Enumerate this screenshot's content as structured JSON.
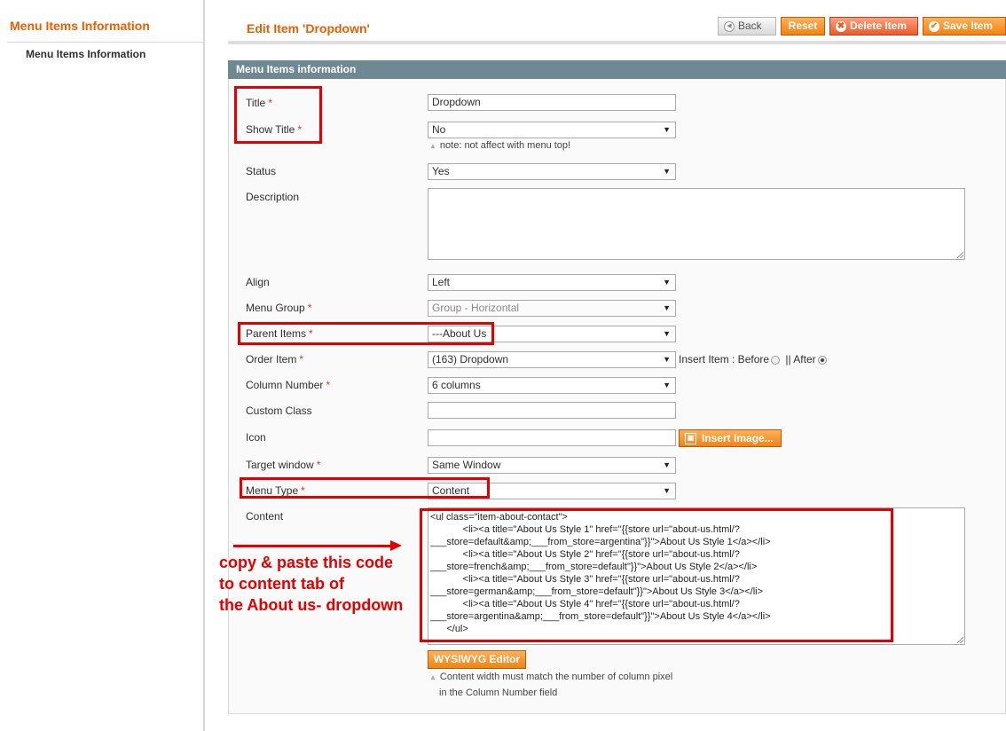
{
  "sidebar": {
    "title": "Menu Items Information",
    "items": [
      {
        "label": "Menu Items Information"
      }
    ]
  },
  "header": {
    "title": "Edit Item 'Dropdown'",
    "buttons": {
      "back": "Back",
      "reset": "Reset",
      "delete": "Delete Item",
      "save": "Save Item"
    }
  },
  "panel": {
    "title": "Menu Items information"
  },
  "form": {
    "title": {
      "label": "Title",
      "value": "Dropdown"
    },
    "show_title": {
      "label": "Show Title",
      "value": "No",
      "note": "note: not affect with menu top!"
    },
    "status": {
      "label": "Status",
      "value": "Yes"
    },
    "description": {
      "label": "Description",
      "value": ""
    },
    "align": {
      "label": "Align",
      "value": "Left"
    },
    "menu_group": {
      "label": "Menu Group",
      "value": "Group - Horizontal"
    },
    "parent_items": {
      "label": "Parent Items",
      "value": "---About Us"
    },
    "order_item": {
      "label": "Order Item",
      "value": "(163) Dropdown",
      "insert_label": "Insert Item : Before",
      "separator": "|| After",
      "selected": "After"
    },
    "column_number": {
      "label": "Column Number",
      "value": "6 columns"
    },
    "custom_class": {
      "label": "Custom Class",
      "value": ""
    },
    "icon": {
      "label": "Icon",
      "value": "",
      "insert_button": "Insert Image..."
    },
    "target_window": {
      "label": "Target window",
      "value": "Same Window"
    },
    "menu_type": {
      "label": "Menu Type",
      "value": "Content"
    },
    "content": {
      "label": "Content",
      "value": "<ul class=\"item-about-contact\">\n            <li><a title=\"About Us Style 1\" href=\"{{store url=\"about-us.html/?\n___store=default&amp;___from_store=argentina\"}}\">About Us Style 1</a></li>\n            <li><a title=\"About Us Style 2\" href=\"{{store url=\"about-us.html/?\n___store=french&amp;___from_store=default\"}}\">About Us Style 2</a></li>\n            <li><a title=\"About Us Style 3\" href=\"{{store url=\"about-us.html/?\n___store=german&amp;___from_store=default\"}}\">About Us Style 3</a></li>\n            <li><a title=\"About Us Style 4\" href=\"{{store url=\"about-us.html/?\n___store=argentina&amp;___from_store=default\"}}\">About Us Style 4</a></li>\n      </ul>",
      "wysiwyg_button": "WYSIWYG Editor",
      "note_line1": "Content width must match the number of column pixel",
      "note_line2": "in the Column Number field"
    },
    "required_mark": "*"
  },
  "annotation": {
    "line1": "copy & paste this code",
    "line2": "to content tab of",
    "line3": "the About us- dropdown"
  },
  "colors": {
    "accent": "#eb5e00",
    "panel_header": "#6f8992",
    "annotation_red": "#e30000"
  }
}
